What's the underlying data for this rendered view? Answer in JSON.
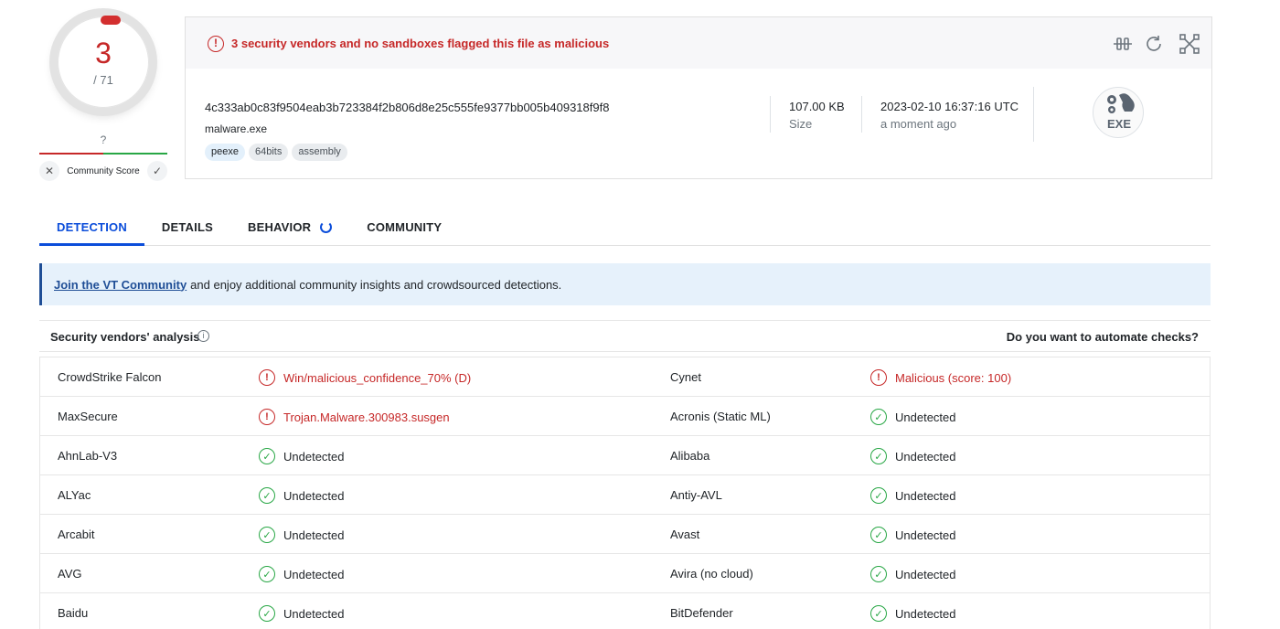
{
  "score": {
    "detections": "3",
    "total": "/ 71"
  },
  "community": {
    "question": "?",
    "label": "Community Score",
    "down_icon": "close-icon",
    "up_icon": "check-icon"
  },
  "alert": {
    "text": "3 security vendors and no sandboxes flagged this file as malicious"
  },
  "file": {
    "hash": "4c333ab0c83f9504eab3b723384f2b806d8e25c555fe9377bb005b409318f9f8",
    "name": "malware.exe",
    "tags": [
      "peexe",
      "64bits",
      "assembly"
    ],
    "size_value": "107.00 KB",
    "size_label": "Size",
    "date_value": "2023-02-10 16:37:16 UTC",
    "date_label": "a moment ago",
    "type_badge": "EXE"
  },
  "tabs": [
    {
      "label": "DETECTION",
      "active": true
    },
    {
      "label": "DETAILS"
    },
    {
      "label": "BEHAVIOR"
    },
    {
      "label": "COMMUNITY"
    }
  ],
  "banner": {
    "link": "Join the VT Community",
    "text": "and enjoy additional community insights and crowdsourced detections."
  },
  "analysis": {
    "title": "Security vendors' analysis",
    "automate": "Do you want to automate checks?"
  },
  "vendors": [
    {
      "left": {
        "name": "CrowdStrike Falcon",
        "result": "Win/malicious_confidence_70% (D)",
        "malicious": true
      },
      "right": {
        "name": "Cynet",
        "result": "Malicious (score: 100)",
        "malicious": true
      }
    },
    {
      "left": {
        "name": "MaxSecure",
        "result": "Trojan.Malware.300983.susgen",
        "malicious": true
      },
      "right": {
        "name": "Acronis (Static ML)",
        "result": "Undetected",
        "malicious": false
      }
    },
    {
      "left": {
        "name": "AhnLab-V3",
        "result": "Undetected",
        "malicious": false
      },
      "right": {
        "name": "Alibaba",
        "result": "Undetected",
        "malicious": false
      }
    },
    {
      "left": {
        "name": "ALYac",
        "result": "Undetected",
        "malicious": false
      },
      "right": {
        "name": "Antiy-AVL",
        "result": "Undetected",
        "malicious": false
      }
    },
    {
      "left": {
        "name": "Arcabit",
        "result": "Undetected",
        "malicious": false
      },
      "right": {
        "name": "Avast",
        "result": "Undetected",
        "malicious": false
      }
    },
    {
      "left": {
        "name": "AVG",
        "result": "Undetected",
        "malicious": false
      },
      "right": {
        "name": "Avira (no cloud)",
        "result": "Undetected",
        "malicious": false
      }
    },
    {
      "left": {
        "name": "Baidu",
        "result": "Undetected",
        "malicious": false
      },
      "right": {
        "name": "BitDefender",
        "result": "Undetected",
        "malicious": false
      }
    }
  ],
  "colors": {
    "malicious": "#c62828",
    "clean": "#28a745",
    "accent": "#0b4dda"
  }
}
